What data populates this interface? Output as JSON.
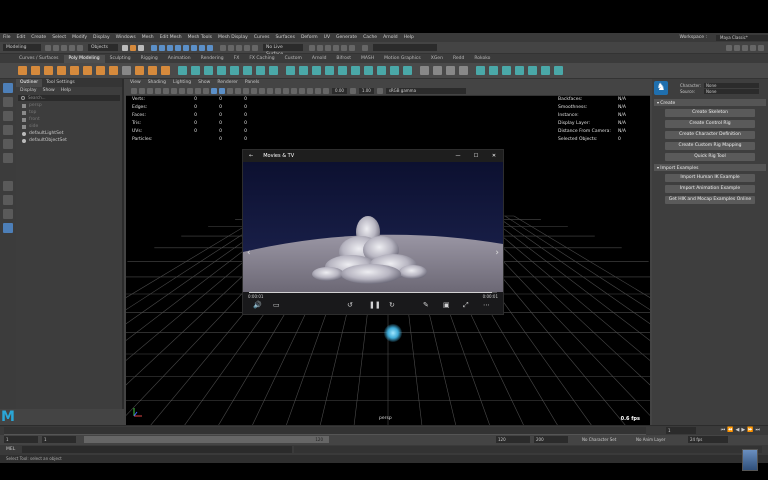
{
  "menubar": {
    "items": [
      "File",
      "Edit",
      "Create",
      "Select",
      "Modify",
      "Display",
      "Windows",
      "Mesh",
      "Edit Mesh",
      "Mesh Tools",
      "Mesh Display",
      "Curves",
      "Surfaces",
      "Deform",
      "UV",
      "Generate",
      "Cache",
      "Arnold",
      "Help"
    ],
    "workspace_label": "Workspace :",
    "workspace_value": "Maya Classic*"
  },
  "statusline": {
    "mode": "Modeling",
    "objects": "Objects",
    "live_surface": "No Live Surface"
  },
  "shelf_tabs": [
    "Curves / Surfaces",
    "Poly Modeling",
    "Sculpting",
    "Rigging",
    "Animation",
    "Rendering",
    "FX",
    "FX Caching",
    "Custom",
    "Arnold",
    "Bifrost",
    "MASH",
    "Motion Graphics",
    "XGen",
    "Redd",
    "Rokoko"
  ],
  "shelf_active": "Poly Modeling",
  "outliner": {
    "tabs": [
      "Outliner",
      "Tool Settings"
    ],
    "menu": [
      "Display",
      "Show",
      "Help"
    ],
    "search_placeholder": "Search...",
    "items": [
      {
        "label": "persp",
        "dim": true
      },
      {
        "label": "top",
        "dim": true
      },
      {
        "label": "front",
        "dim": true
      },
      {
        "label": "side",
        "dim": true
      },
      {
        "label": "defaultLightSet",
        "dim": false
      },
      {
        "label": "defaultObjectSet",
        "dim": false
      }
    ]
  },
  "viewport": {
    "menu": [
      "View",
      "Shading",
      "Lighting",
      "Show",
      "Renderer",
      "Panels"
    ],
    "near": "0.00",
    "far": "1.00",
    "colorspace": "sRGB gamma",
    "hud_left": [
      {
        "label": "Verts:",
        "a": "0",
        "b": "0",
        "c": "0"
      },
      {
        "label": "Edges:",
        "a": "0",
        "b": "0",
        "c": "0"
      },
      {
        "label": "Faces:",
        "a": "0",
        "b": "0",
        "c": "0"
      },
      {
        "label": "Tris:",
        "a": "0",
        "b": "0",
        "c": "0"
      },
      {
        "label": "UVs:",
        "a": "0",
        "b": "0",
        "c": "0"
      },
      {
        "label": "Particles:",
        "a": "",
        "b": "0",
        "c": "0"
      }
    ],
    "hud_right": [
      {
        "label": "Backfaces:",
        "v": "N/A"
      },
      {
        "label": "Smoothness:",
        "v": "N/A"
      },
      {
        "label": "Instance:",
        "v": "N/A"
      },
      {
        "label": "Display Layer:",
        "v": "N/A"
      },
      {
        "label": "Distance From Camera:",
        "v": "N/A"
      },
      {
        "label": "Selected Objects:",
        "v": "0"
      }
    ],
    "camera": "persp",
    "fps": "0.6 fps"
  },
  "player": {
    "title": "Movies & TV",
    "time_current": "0:00:01",
    "time_total": "0:00:01",
    "progress": 0.98
  },
  "attr_panel": {
    "character_label": "Character:",
    "character_value": "None",
    "source_label": "Source:",
    "source_value": "None",
    "sections": [
      {
        "title": "Create",
        "buttons": [
          "Create Skeleton",
          "Create Control Rig",
          "Create Character Definition",
          "Create Custom Rig Mapping",
          "Quick Rig Tool"
        ]
      },
      {
        "title": "Import Examples",
        "buttons": [
          "Import Human IK Example",
          "Import Animation Example",
          "Get HIK and Mocap Examples Online"
        ]
      }
    ]
  },
  "timeslider": {
    "current_frame": "1",
    "start": "1",
    "start2": "1",
    "range_end": "120",
    "end": "120",
    "end2": "200",
    "no_char_set": "No Character Set",
    "no_anim_layer": "No Anim Layer",
    "fps": "24 fps"
  },
  "cmdline": {
    "label": "MEL"
  },
  "help_line": "Select Tool: select an object"
}
